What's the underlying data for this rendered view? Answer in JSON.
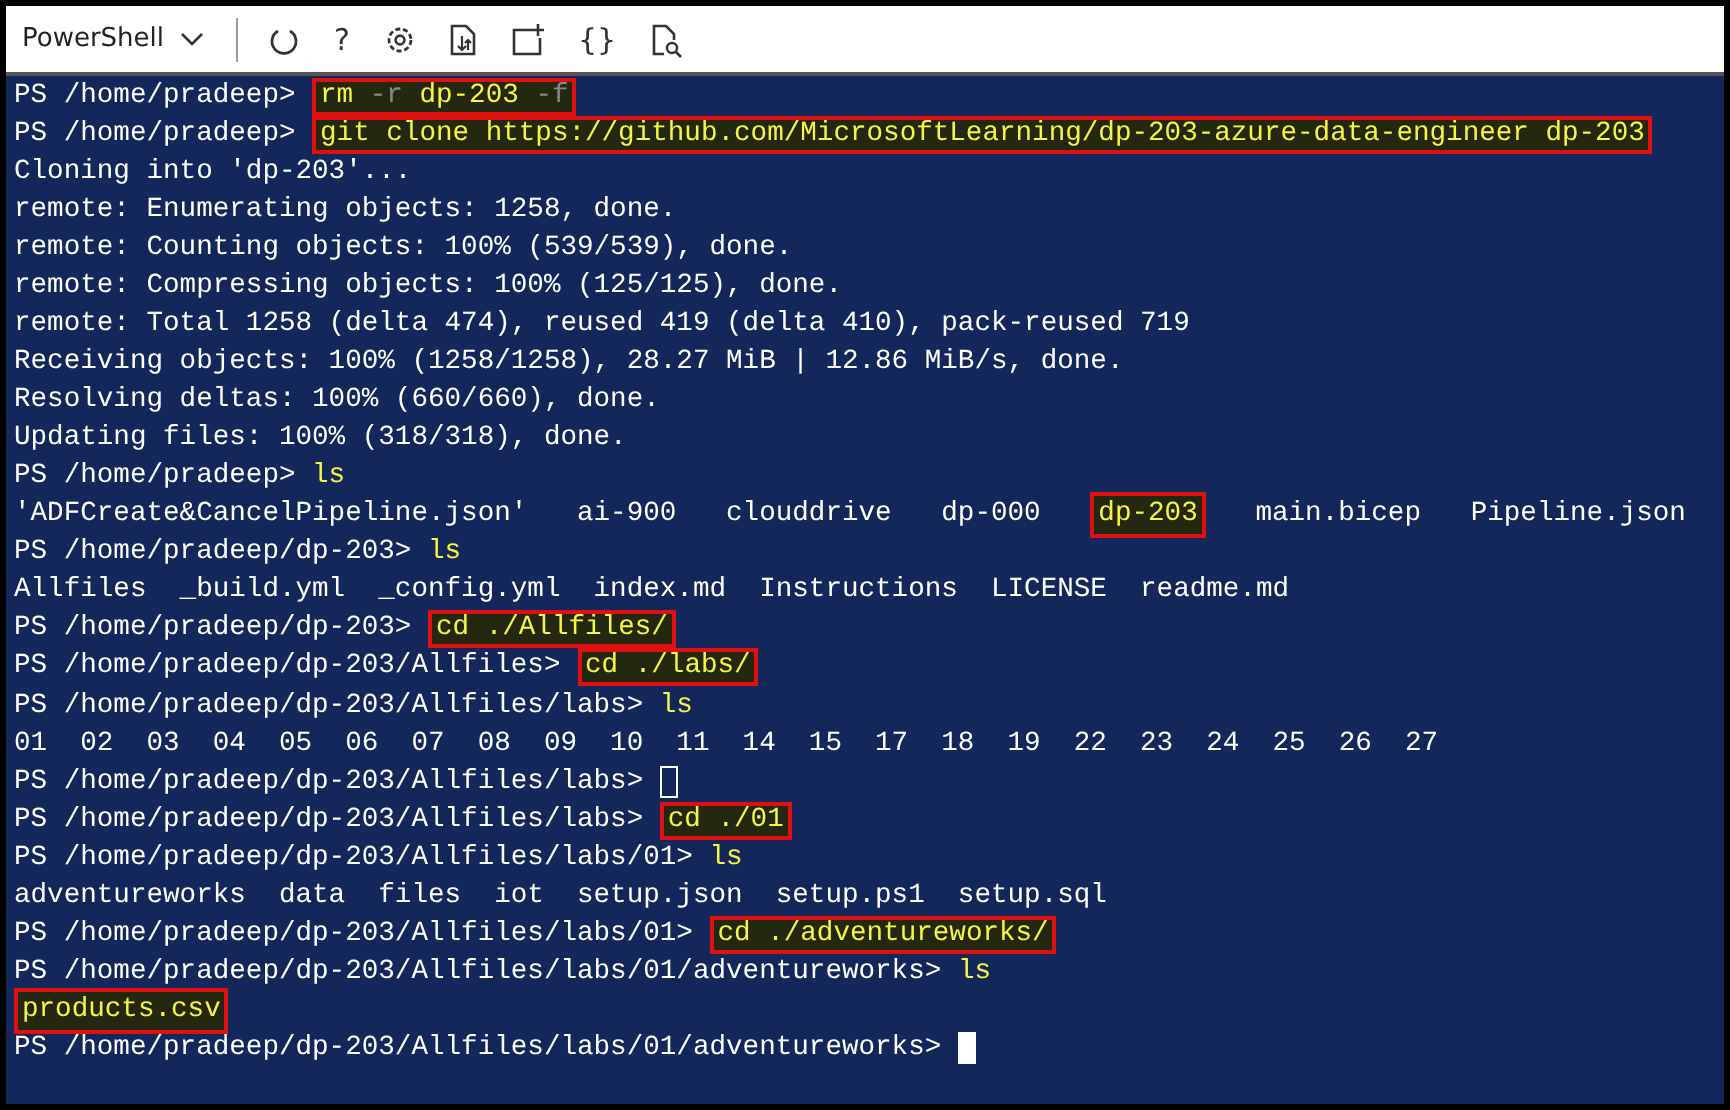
{
  "toolbar": {
    "shell": "PowerShell",
    "items": [
      {
        "kind": "restart"
      },
      {
        "kind": "text",
        "label": "?"
      },
      {
        "kind": "settings"
      },
      {
        "kind": "transfer"
      },
      {
        "kind": "new-session"
      },
      {
        "kind": "text",
        "label": "{}"
      },
      {
        "kind": "preview"
      }
    ]
  },
  "terminal": {
    "lines": [
      [
        {
          "kind": "prompt",
          "text": "PS /home/pradeep> "
        },
        {
          "kind": "command",
          "boxed": true,
          "tokens": [
            {
              "kind": "cmd",
              "text": "rm "
            },
            {
              "kind": "flag",
              "text": "-r "
            },
            {
              "kind": "cmd",
              "text": "dp-203 "
            },
            {
              "kind": "flag",
              "text": "-f"
            }
          ]
        }
      ],
      [
        {
          "kind": "prompt",
          "text": "PS /home/pradeep> "
        },
        {
          "kind": "command",
          "boxed": true,
          "tokens": [
            {
              "kind": "cmd",
              "text": "git clone https://github.com/MicrosoftLearning/dp-203-azure-data-engineer dp-203"
            }
          ]
        }
      ],
      [
        {
          "kind": "output",
          "text": "Cloning into 'dp-203'..."
        }
      ],
      [
        {
          "kind": "output",
          "text": "remote: Enumerating objects: 1258, done."
        }
      ],
      [
        {
          "kind": "output",
          "text": "remote: Counting objects: 100% (539/539), done."
        }
      ],
      [
        {
          "kind": "output",
          "text": "remote: Compressing objects: 100% (125/125), done."
        }
      ],
      [
        {
          "kind": "output",
          "text": "remote: Total 1258 (delta 474), reused 419 (delta 410), pack-reused 719"
        }
      ],
      [
        {
          "kind": "output",
          "text": "Receiving objects: 100% (1258/1258), 28.27 MiB | 12.86 MiB/s, done."
        }
      ],
      [
        {
          "kind": "output",
          "text": "Resolving deltas: 100% (660/660), done."
        }
      ],
      [
        {
          "kind": "output",
          "text": "Updating files: 100% (318/318), done."
        }
      ],
      [
        {
          "kind": "prompt",
          "text": "PS /home/pradeep> "
        },
        {
          "kind": "command",
          "boxed": false,
          "tokens": [
            {
              "kind": "cmd",
              "text": "ls"
            }
          ]
        }
      ],
      [
        {
          "kind": "output",
          "text": "'ADFCreate&CancelPipeline.json'   ai-900   clouddrive   dp-000   "
        },
        {
          "kind": "entry",
          "boxed": true,
          "text": "dp-203"
        },
        {
          "kind": "output",
          "text": "   main.bicep   Pipeline.json"
        }
      ],
      [
        {
          "kind": "prompt",
          "text": "PS /home/pradeep/dp-203> "
        },
        {
          "kind": "command",
          "boxed": false,
          "tokens": [
            {
              "kind": "cmd",
              "text": "ls"
            }
          ]
        }
      ],
      [
        {
          "kind": "output",
          "text": "Allfiles  _build.yml  _config.yml  index.md  Instructions  LICENSE  readme.md"
        }
      ],
      [
        {
          "kind": "prompt",
          "text": "PS /home/pradeep/dp-203> "
        },
        {
          "kind": "command",
          "boxed": true,
          "tokens": [
            {
              "kind": "cmd",
              "text": "cd ./Allfiles/"
            }
          ]
        }
      ],
      [
        {
          "kind": "prompt",
          "text": "PS /home/pradeep/dp-203/Allfiles> "
        },
        {
          "kind": "command",
          "boxed": true,
          "tokens": [
            {
              "kind": "cmd",
              "text": "cd ./labs/"
            }
          ]
        }
      ],
      [
        {
          "kind": "prompt",
          "text": "PS /home/pradeep/dp-203/Allfiles/labs> "
        },
        {
          "kind": "command",
          "boxed": false,
          "tokens": [
            {
              "kind": "cmd",
              "text": "ls"
            }
          ]
        }
      ],
      [
        {
          "kind": "output",
          "text": "01  02  03  04  05  06  07  08  09  10  11  14  15  17  18  19  22  23  24  25  26  27"
        }
      ],
      [
        {
          "kind": "prompt",
          "text": "PS /home/pradeep/dp-203/Allfiles/labs> "
        },
        {
          "kind": "cursor",
          "focused": false
        }
      ],
      [
        {
          "kind": "prompt",
          "text": "PS /home/pradeep/dp-203/Allfiles/labs> "
        },
        {
          "kind": "command",
          "boxed": true,
          "tokens": [
            {
              "kind": "cmd",
              "text": "cd ./01"
            }
          ]
        }
      ],
      [
        {
          "kind": "prompt",
          "text": "PS /home/pradeep/dp-203/Allfiles/labs/01> "
        },
        {
          "kind": "command",
          "boxed": false,
          "tokens": [
            {
              "kind": "cmd",
              "text": "ls"
            }
          ]
        }
      ],
      [
        {
          "kind": "output",
          "text": "adventureworks  data  files  iot  setup.json  setup.ps1  setup.sql"
        }
      ],
      [
        {
          "kind": "prompt",
          "text": "PS /home/pradeep/dp-203/Allfiles/labs/01> "
        },
        {
          "kind": "command",
          "boxed": true,
          "tokens": [
            {
              "kind": "cmd",
              "text": "cd ./adventureworks/"
            }
          ]
        }
      ],
      [
        {
          "kind": "prompt",
          "text": "PS /home/pradeep/dp-203/Allfiles/labs/01/adventureworks> "
        },
        {
          "kind": "command",
          "boxed": false,
          "tokens": [
            {
              "kind": "cmd",
              "text": "ls"
            }
          ]
        }
      ],
      [
        {
          "kind": "entry",
          "boxed": true,
          "text": "products.csv"
        }
      ],
      [
        {
          "kind": "prompt",
          "text": "PS /home/pradeep/dp-203/Allfiles/labs/01/adventureworks> "
        },
        {
          "kind": "cursor",
          "focused": true
        }
      ]
    ]
  }
}
